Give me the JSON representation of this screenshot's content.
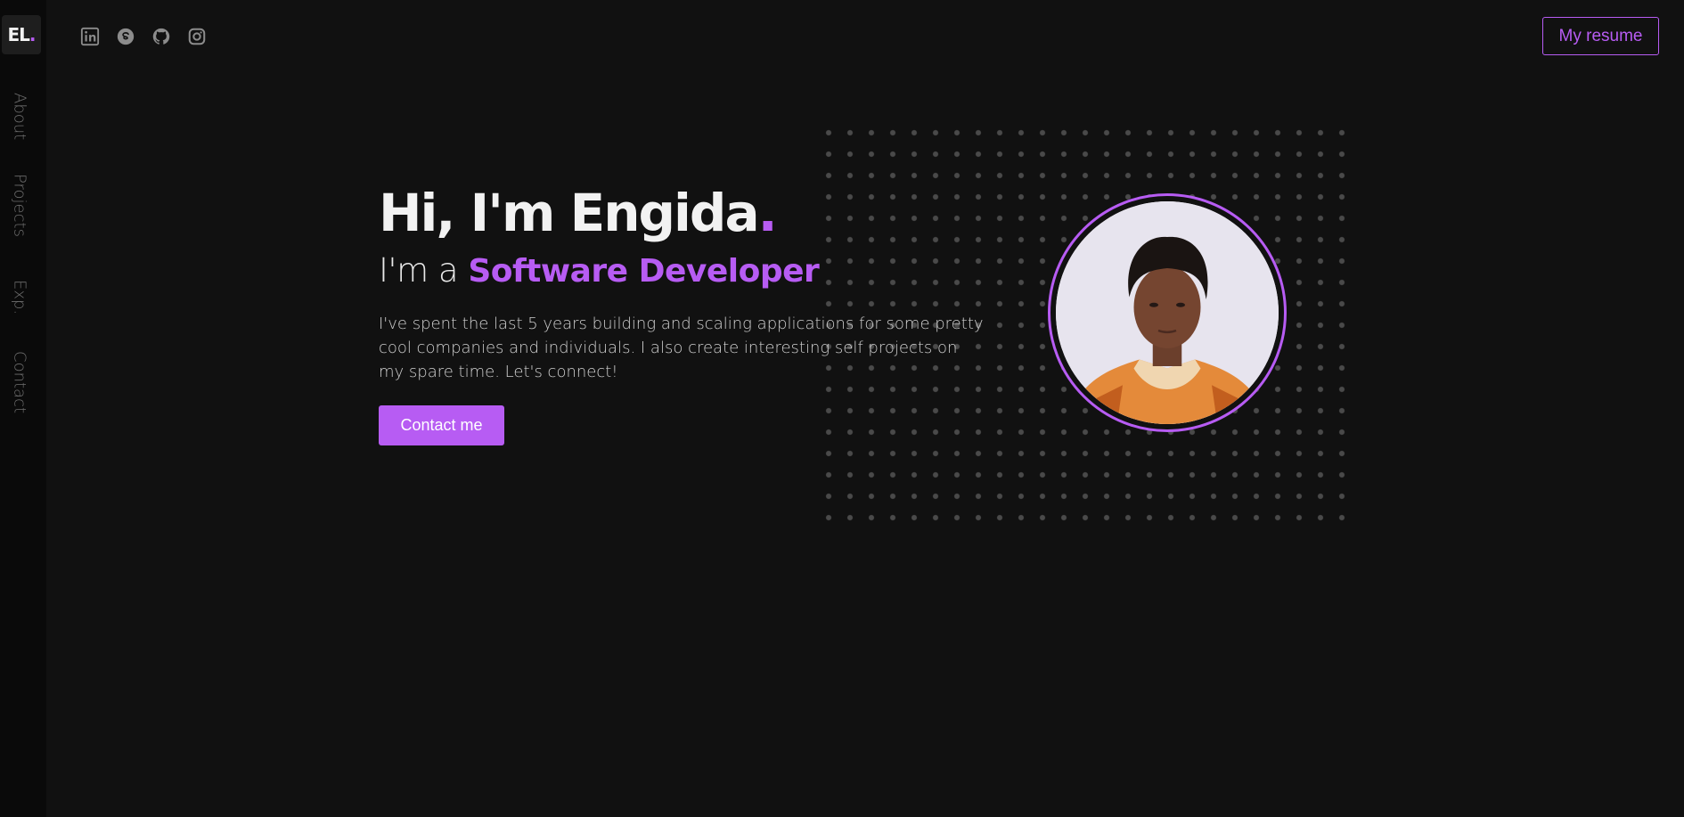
{
  "logo": {
    "text": "EL",
    "dot": "."
  },
  "sidebar": {
    "items": [
      {
        "label": "About"
      },
      {
        "label": "Projects"
      },
      {
        "label": "Exp."
      },
      {
        "label": "Contact"
      }
    ]
  },
  "social": [
    {
      "icon": "linkedin-icon"
    },
    {
      "icon": "skype-icon"
    },
    {
      "icon": "github-icon"
    },
    {
      "icon": "instagram-icon"
    }
  ],
  "header": {
    "resume_label": "My resume"
  },
  "hero": {
    "greeting": "Hi, I'm Engida",
    "greeting_dot": ".",
    "role_prefix": "I'm a ",
    "role": "Software Developer",
    "description": "I've spent the last 5 years building and scaling applications for some pretty cool companies and individuals. I also create interesting self projects on my spare time. Let's connect!",
    "contact_label": "Contact me"
  },
  "colors": {
    "accent": "#b75cf3",
    "background": "#111111",
    "sidebar": "#0a0a0a"
  }
}
